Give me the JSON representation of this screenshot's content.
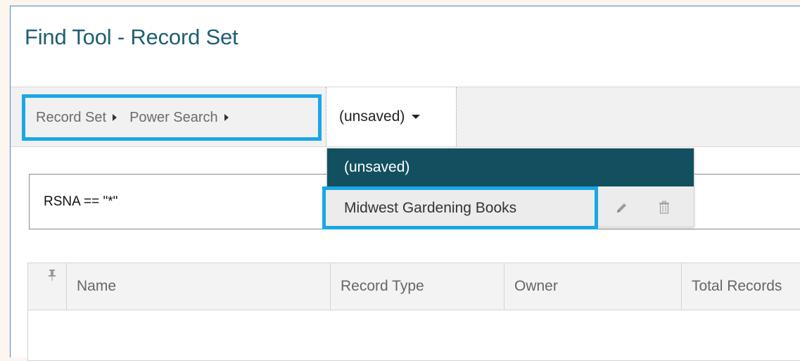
{
  "header": {
    "title": "Find Tool - Record Set"
  },
  "breadcrumb": {
    "items": [
      {
        "label": "Record Set"
      },
      {
        "label": "Power Search"
      }
    ]
  },
  "record_set_select": {
    "value": "(unsaved)"
  },
  "dropdown": {
    "items": [
      {
        "label": "(unsaved)",
        "selected": true
      },
      {
        "label": "Midwest Gardening Books",
        "selected": false
      }
    ],
    "item_icons": [
      "pencil-icon",
      "trash-icon"
    ]
  },
  "query": {
    "text": "RSNA == \"*\""
  },
  "table": {
    "columns": [
      "Name",
      "Record Type",
      "Owner",
      "Total Records"
    ],
    "pin_icon": "pin-icon"
  },
  "colors": {
    "title": "#1e5f70",
    "highlight_border": "#1aa7e8",
    "dropdown_selected_bg": "#13505f"
  }
}
